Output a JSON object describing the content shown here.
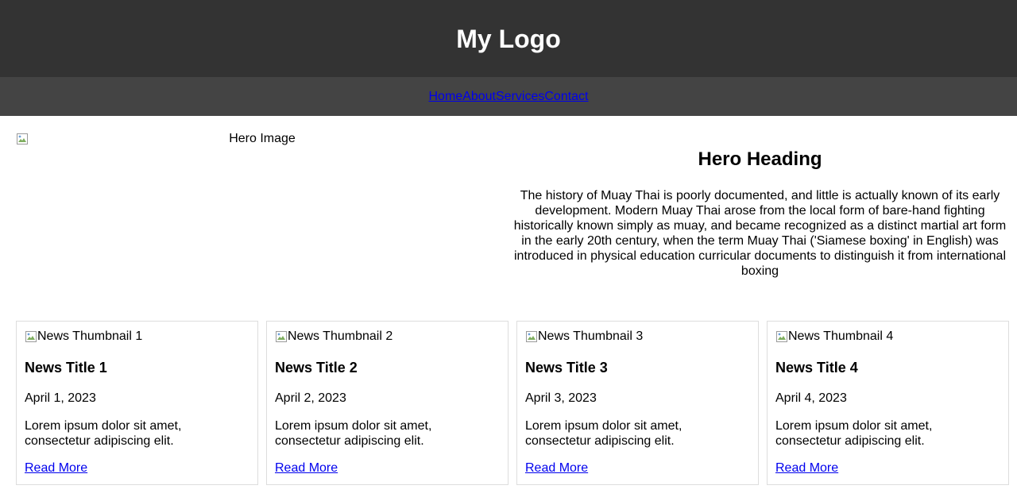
{
  "header": {
    "logo": "My Logo"
  },
  "nav": {
    "items": [
      {
        "label": "Home"
      },
      {
        "label": "About"
      },
      {
        "label": "Services"
      },
      {
        "label": "Contact"
      }
    ]
  },
  "hero": {
    "image_alt": "Hero Image",
    "heading": "Hero Heading",
    "text": "The history of Muay Thai is poorly documented, and little is actually known of its early development. Modern Muay Thai arose from the local form of bare-hand fighting historically known simply as muay, and became recognized as a distinct martial art form in the early 20th century, when the term Muay Thai ('Siamese boxing' in English) was introduced in physical education curricular documents to distinguish it from international boxing"
  },
  "news": [
    {
      "thumb_alt": "News Thumbnail 1",
      "title": "News Title 1",
      "date": "April 1, 2023",
      "desc": "Lorem ipsum dolor sit amet, consectetur adipiscing elit.",
      "link": "Read More"
    },
    {
      "thumb_alt": "News Thumbnail 2",
      "title": "News Title 2",
      "date": "April 2, 2023",
      "desc": "Lorem ipsum dolor sit amet, consectetur adipiscing elit.",
      "link": "Read More"
    },
    {
      "thumb_alt": "News Thumbnail 3",
      "title": "News Title 3",
      "date": "April 3, 2023",
      "desc": "Lorem ipsum dolor sit amet, consectetur adipiscing elit.",
      "link": "Read More"
    },
    {
      "thumb_alt": "News Thumbnail 4",
      "title": "News Title 4",
      "date": "April 4, 2023",
      "desc": "Lorem ipsum dolor sit amet, consectetur adipiscing elit.",
      "link": "Read More"
    }
  ],
  "colors": {
    "header_bg": "#333333",
    "nav_bg": "#444444",
    "link": "#0000ee"
  }
}
